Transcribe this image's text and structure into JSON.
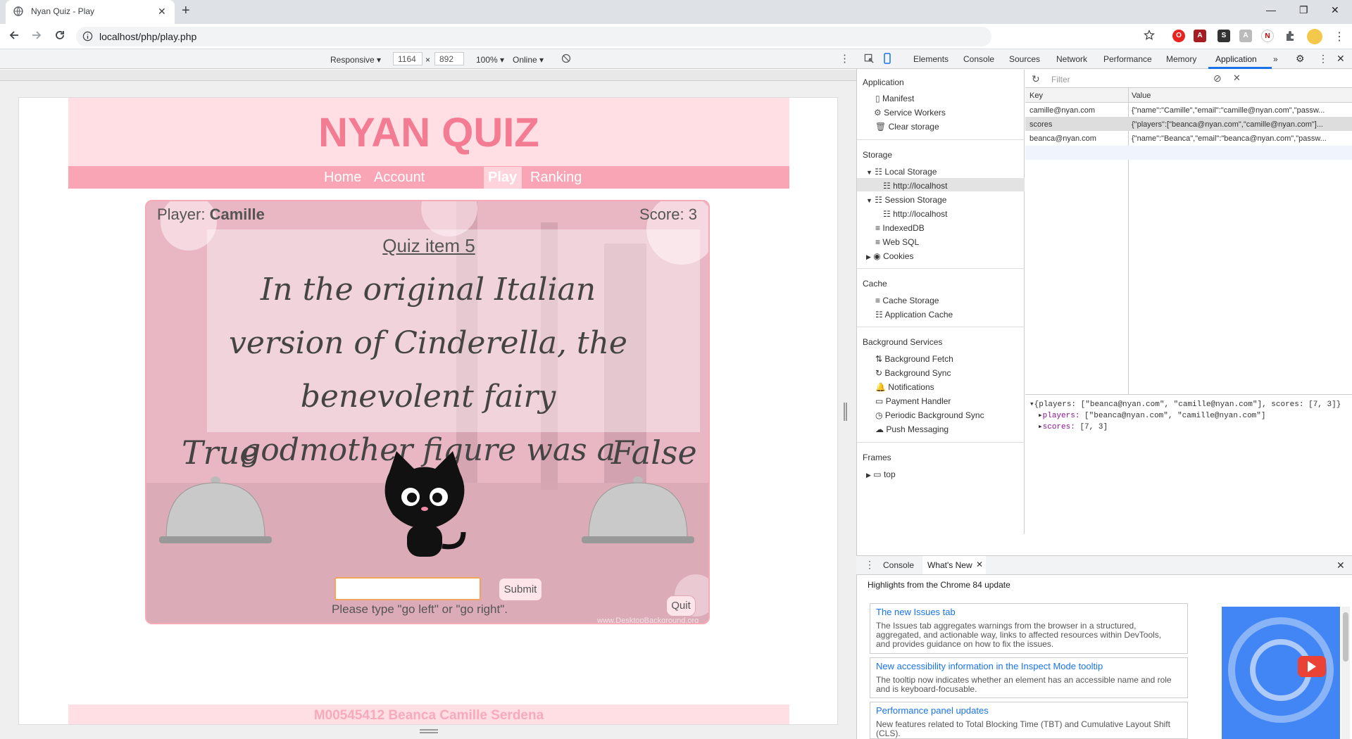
{
  "browser": {
    "tab_title": "Nyan Quiz - Play",
    "new_tab_symbol": "+",
    "url": "localhost/php/play.php"
  },
  "emulation": {
    "device": "Responsive",
    "width": "1164",
    "times": "×",
    "height": "892",
    "zoom": "100%",
    "network": "Online"
  },
  "site": {
    "title": "NYAN QUIZ",
    "nav": [
      "Home",
      "Account",
      "Play",
      "Ranking"
    ],
    "footer": "M00545412 Beanca Camille Serdena"
  },
  "game": {
    "player_label": "Player:",
    "player_name": "Camille",
    "score_label": "Score: 3",
    "quiz_heading": "Quiz item 5",
    "question": "In the original Italian version of Cinderella, the benevolent fairy godmother figure was a cat.",
    "true_label": "True",
    "false_label": "False",
    "answer_value": "",
    "submit_label": "Submit",
    "hint": "Please type \"go left\" or \"go right\".",
    "quit_label": "Quit",
    "watermark": "www.DesktopBackground.org"
  },
  "devtools": {
    "tabs": [
      "Elements",
      "Console",
      "Sources",
      "Network",
      "Performance",
      "Memory",
      "Application"
    ],
    "active_tab": "Application",
    "sidebar": {
      "application_header": "Application",
      "application_items": [
        "Manifest",
        "Service Workers",
        "Clear storage"
      ],
      "storage_header": "Storage",
      "local_storage": "Local Storage",
      "local_origin": "http://localhost",
      "session_storage": "Session Storage",
      "session_origin": "http://localhost",
      "indexeddb": "IndexedDB",
      "websql": "Web SQL",
      "cookies": "Cookies",
      "cache_header": "Cache",
      "cache_items": [
        "Cache Storage",
        "Application Cache"
      ],
      "bg_header": "Background Services",
      "bg_items": [
        "Background Fetch",
        "Background Sync",
        "Notifications",
        "Payment Handler",
        "Periodic Background Sync",
        "Push Messaging"
      ],
      "frames_header": "Frames",
      "frames_top": "top"
    },
    "filter_placeholder": "Filter",
    "table": {
      "headers": [
        "Key",
        "Value"
      ],
      "rows": [
        [
          "camille@nyan.com",
          "{\"name\":\"Camille\",\"email\":\"camille@nyan.com\",\"passw..."
        ],
        [
          "scores",
          "{\"players\":[\"beanca@nyan.com\",\"camille@nyan.com\"]..."
        ],
        [
          "beanca@nyan.com",
          "{\"name\":\"Beanca\",\"email\":\"beanca@nyan.com\",\"passw..."
        ]
      ]
    },
    "preview": {
      "line1": "{players: [\"beanca@nyan.com\", \"camille@nyan.com\"], scores: [7, 3]}",
      "players_key": "players:",
      "players_val": "[\"beanca@nyan.com\", \"camille@nyan.com\"]",
      "scores_key": "scores:",
      "scores_val": "[7, 3]"
    },
    "drawer": {
      "tabs": [
        "Console",
        "What's New"
      ],
      "whats_new_heading": "Highlights from the Chrome 84 update",
      "cards": [
        {
          "title": "The new Issues tab",
          "desc": "The Issues tab aggregates warnings from the browser in a structured, aggregated, and actionable way, links to affected resources within DevTools, and provides guidance on how to fix the issues."
        },
        {
          "title": "New accessibility information in the Inspect Mode tooltip",
          "desc": "The tooltip now indicates whether an element has an accessible name and role and is keyboard-focusable."
        },
        {
          "title": "Performance panel updates",
          "desc": "New features related to Total Blocking Time (TBT) and Cumulative Layout Shift (CLS)."
        }
      ]
    }
  },
  "colors": {
    "brand_pink": "#f37b92",
    "nav_pink": "#f9a5b6",
    "header_pink": "#ffdfe4",
    "devtools_accent": "#1a73e8"
  }
}
